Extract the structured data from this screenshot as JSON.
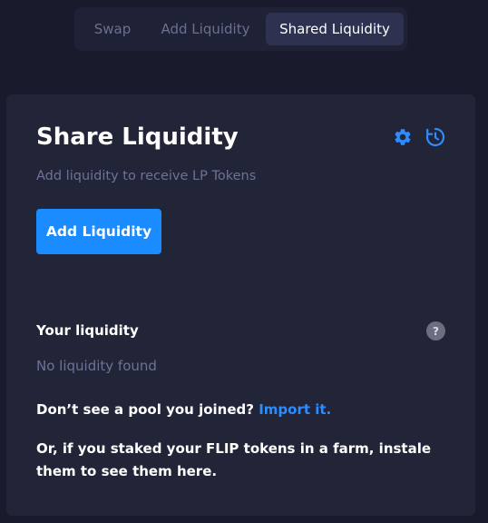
{
  "tabs": [
    {
      "label": "Swap"
    },
    {
      "label": "Add Liquidity"
    },
    {
      "label": "Shared Liquidity",
      "active": true
    }
  ],
  "card": {
    "title": "Share Liquidity",
    "subtitle": "Add liquidity to receive LP Tokens",
    "add_button_label": "Add Liquidity",
    "settings_icon": "gear-icon",
    "history_icon": "history-icon",
    "your_liquidity_label": "Your liquidity",
    "help_icon_glyph": "?",
    "empty_text": "No liquidity found",
    "import_prompt": "Don’t see a pool you joined?",
    "import_link": "Import it.",
    "staked_text": "Or, if you staked your FLIP tokens in a farm, instale them to see them here."
  },
  "colors": {
    "background": "#191b2c",
    "card": "#212537",
    "accent": "#1b8cff",
    "muted_text": "#6f7296"
  }
}
